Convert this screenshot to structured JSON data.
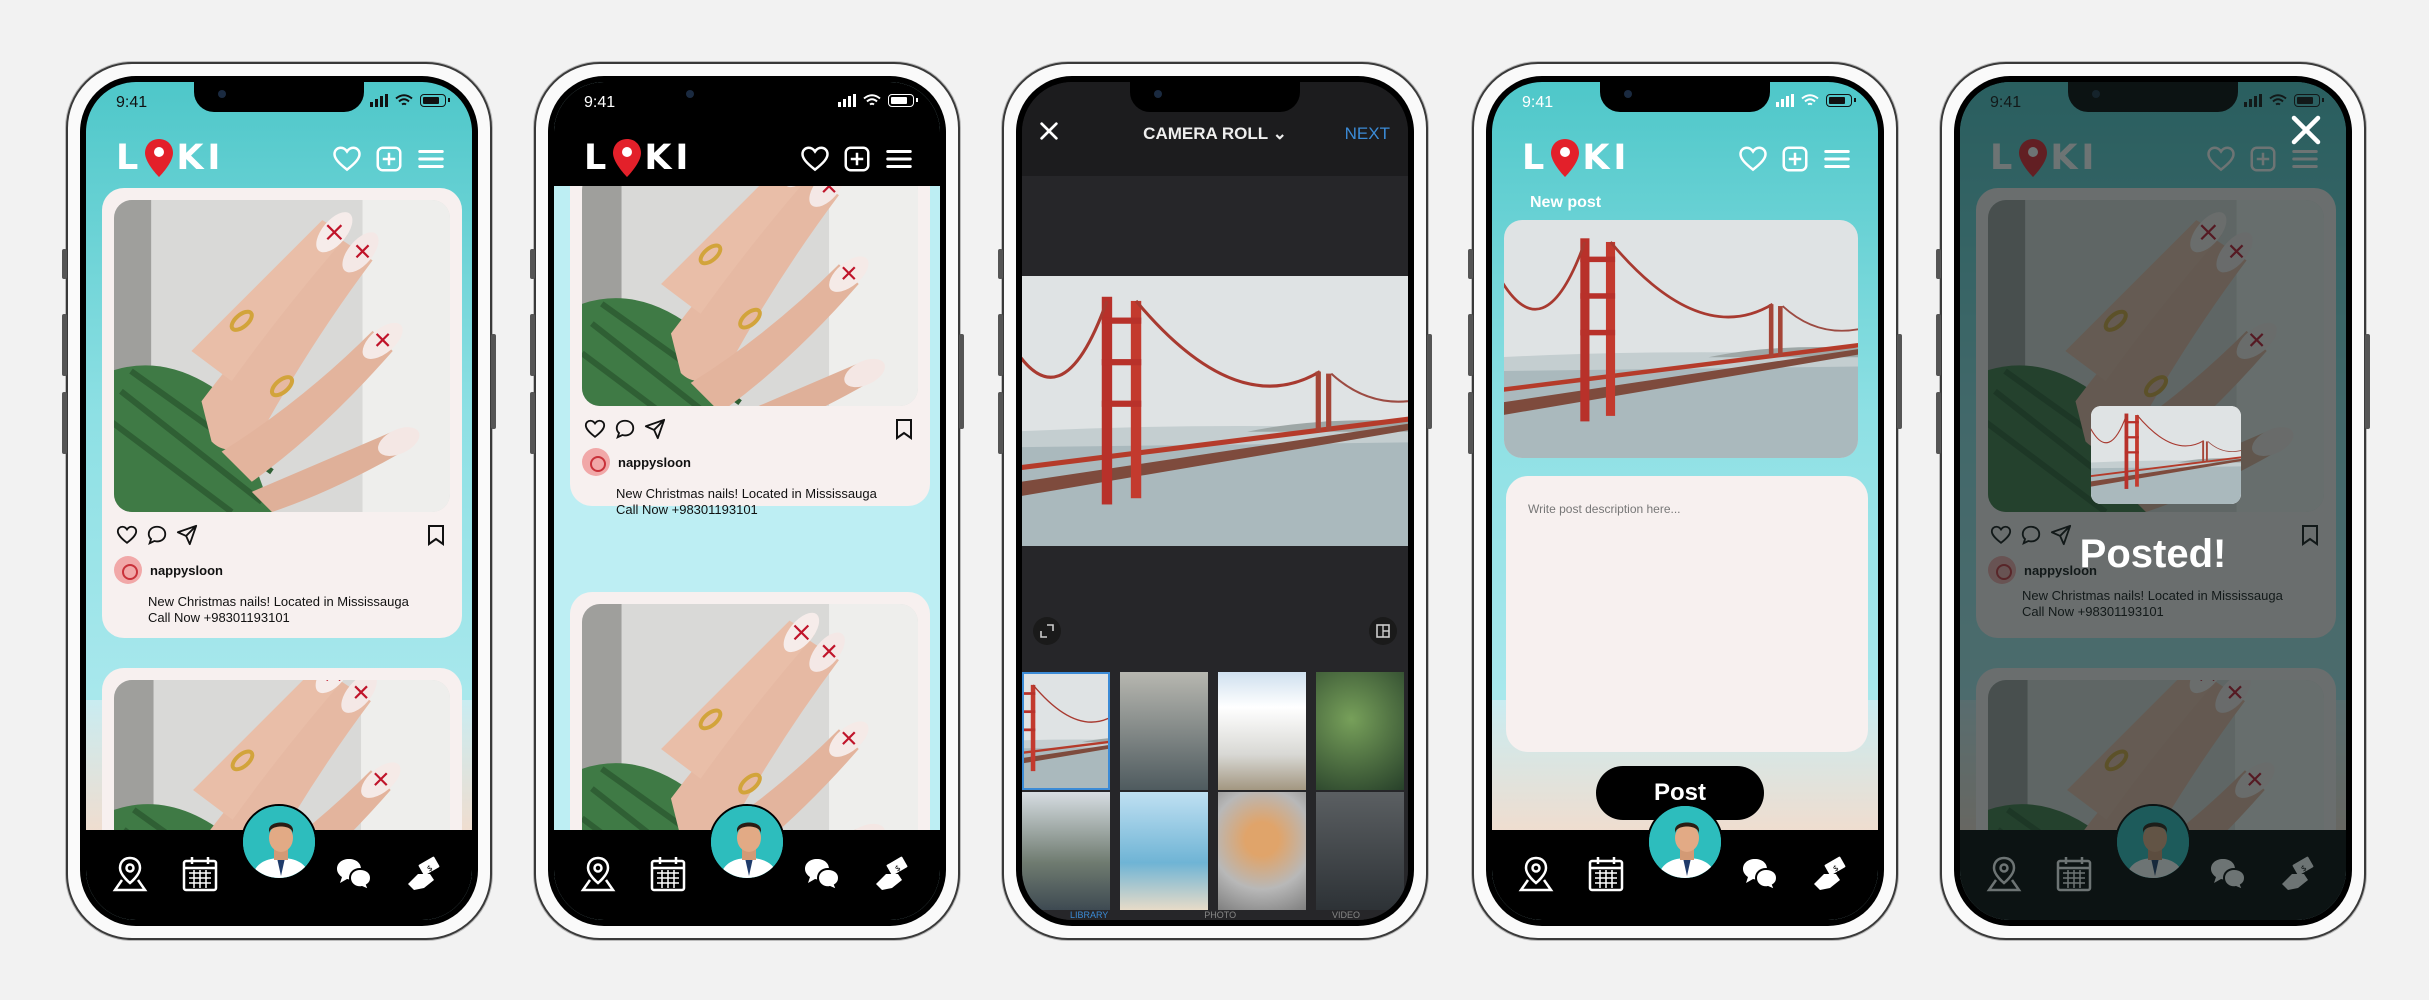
{
  "status": {
    "time": "9:41"
  },
  "brand": {
    "logo_left": "L",
    "logo_right": "KI",
    "pin_color": "#e3202a",
    "teal": "#4ec7c9"
  },
  "post": {
    "username": "nappysloon",
    "caption_line1": "New Christmas nails! Located in Mississauga",
    "caption_line2": "Call Now +98301193101"
  },
  "camera_roll": {
    "title": "CAMERA ROLL",
    "next_label": "NEXT",
    "tabs": [
      "LIBRARY",
      "PHOTO",
      "VIDEO"
    ]
  },
  "new_post": {
    "heading": "New post",
    "description_placeholder": "Write post description here...",
    "post_button": "Post"
  },
  "posted": {
    "message": "Posted!"
  },
  "icons": {
    "top": [
      "heart-icon",
      "add-square-icon",
      "menu-icon"
    ],
    "actions": [
      "heart-icon",
      "comment-icon",
      "share-icon",
      "bookmark-icon"
    ],
    "nav": [
      "map-pin-icon",
      "calendar-icon",
      "profile-avatar",
      "chat-icon",
      "deal-icon"
    ]
  }
}
